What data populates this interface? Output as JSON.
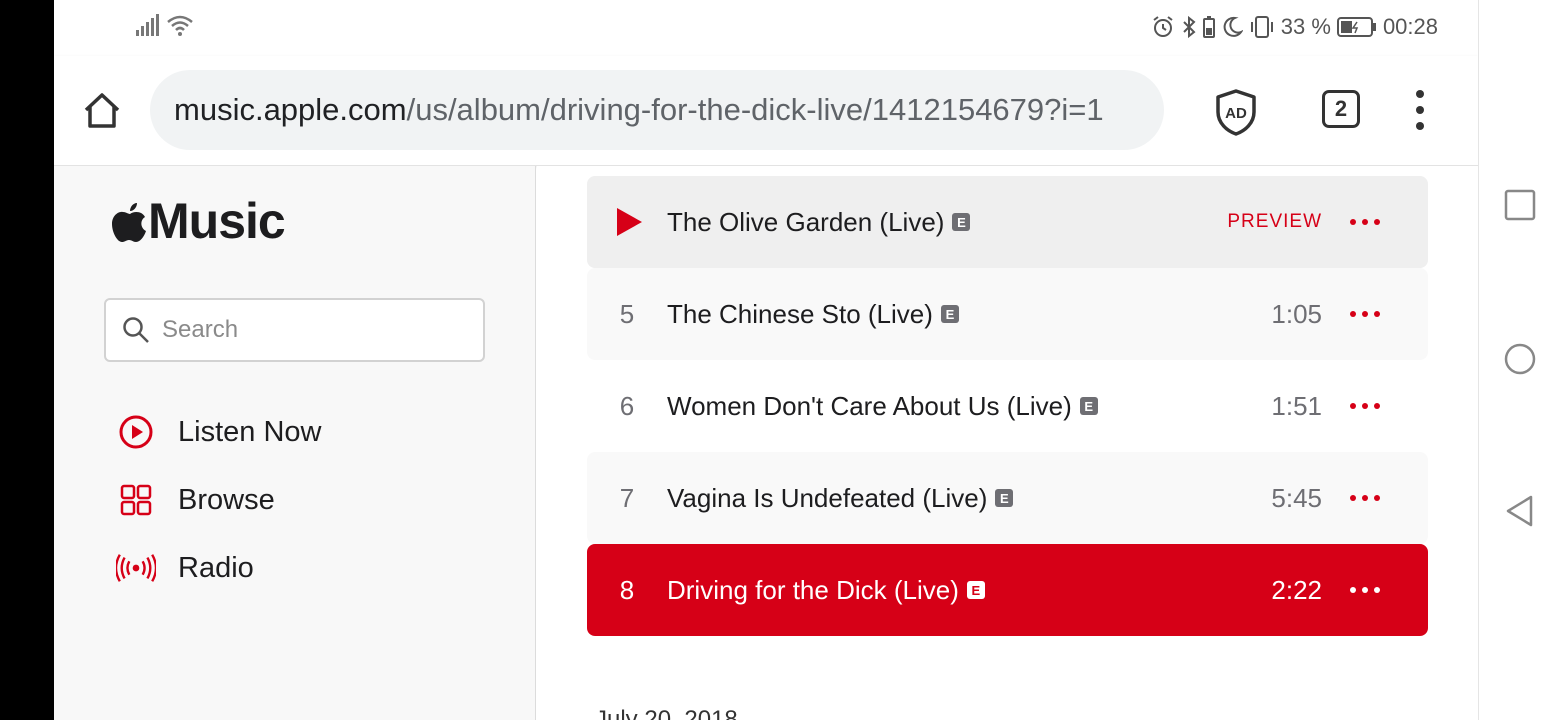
{
  "status_bar": {
    "battery_percent": "33 %",
    "clock": "00:28"
  },
  "browser": {
    "url_host": "music.apple.com",
    "url_path": "/us/album/driving-for-the-dick-live/1412154679?i=1",
    "tab_count": "2",
    "ad_label": "AD"
  },
  "sidebar": {
    "logo_text": "Music",
    "search_placeholder": "Search",
    "items": [
      {
        "label": "Listen Now",
        "icon": "play-circle-icon"
      },
      {
        "label": "Browse",
        "icon": "grid-icon"
      },
      {
        "label": "Radio",
        "icon": "radio-broadcast-icon"
      }
    ]
  },
  "tracks": [
    {
      "number": "",
      "title": "The Olive Garden (Live)",
      "explicit": "E",
      "time": "",
      "preview": "PREVIEW",
      "state": "hover"
    },
    {
      "number": "5",
      "title": "The Chinese Sto (Live)",
      "explicit": "E",
      "time": "1:05",
      "state": "alt"
    },
    {
      "number": "6",
      "title": "Women Don't Care About Us (Live)",
      "explicit": "E",
      "time": "1:51",
      "state": "normal"
    },
    {
      "number": "7",
      "title": "Vagina Is Undefeated (Live)",
      "explicit": "E",
      "time": "5:45",
      "state": "alt"
    },
    {
      "number": "8",
      "title": "Driving for the Dick (Live)",
      "explicit": "E",
      "time": "2:22",
      "state": "active"
    }
  ],
  "release_date": "July 20, 2018",
  "colors": {
    "accent": "#d60017",
    "text": "#1d1d1f",
    "muted": "#6e6e73"
  }
}
